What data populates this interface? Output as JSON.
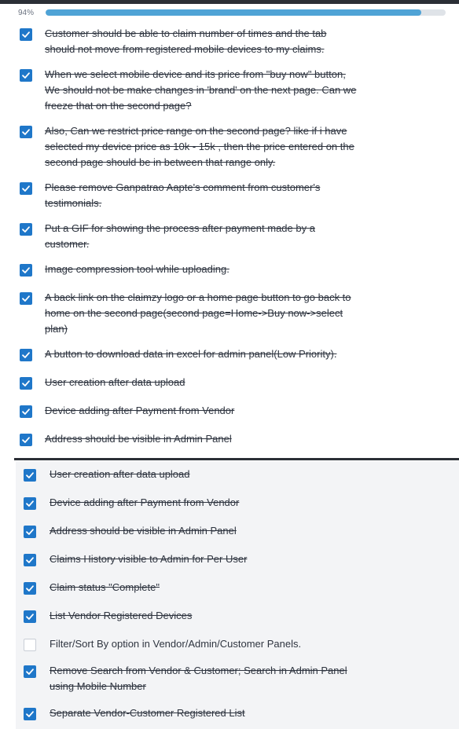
{
  "progress": {
    "percent_label": "94%",
    "fraction": 0.94
  },
  "colors": {
    "accent": "#1f77c9",
    "progress_fill": "#4fa3d6",
    "dark_chrome": "#2b2f36",
    "panel_bg": "#f3f4f6"
  },
  "icons": {
    "checked": "check-icon"
  },
  "list1": {
    "items": [
      {
        "lines": [
          "Customer should be able to claim number of times and the tab",
          "should not move from registered mobile devices to my claims."
        ],
        "checked": true
      },
      {
        "lines": [
          "When we select mobile device and its price from \"buy now\" button,",
          "We should not be make changes in 'brand' on the next page. Can we",
          "freeze that on the second page?"
        ],
        "checked": true
      },
      {
        "lines": [
          "Also, Can we restrict price range on the second page? like if i have",
          "selected my device price as 10k - 15k , then the price entered on the",
          "second page should be in between that range only."
        ],
        "checked": true
      },
      {
        "lines": [
          "Please remove Ganpatrao Aapte's comment from customer's",
          "testimonials."
        ],
        "checked": true
      },
      {
        "lines": [
          "Put a GIF for showing the process after payment made by a",
          "customer."
        ],
        "checked": true
      },
      {
        "lines": [
          "Image compression tool while uploading."
        ],
        "checked": true
      },
      {
        "lines": [
          "A back link on the claimzy logo or a home page button to go back to",
          "home on the second page(second page=Home->Buy now->select",
          "plan)"
        ],
        "checked": true
      },
      {
        "lines": [
          "A button to download data in excel for admin panel(Low Priority)."
        ],
        "checked": true
      },
      {
        "lines": [
          "User creation after data upload"
        ],
        "checked": true
      },
      {
        "lines": [
          "Device adding after Payment from Vendor"
        ],
        "checked": true
      },
      {
        "lines": [
          "Address should be visible in Admin Panel"
        ],
        "checked": true
      }
    ]
  },
  "list2": {
    "items": [
      {
        "lines": [
          "User creation after data upload"
        ],
        "checked": true
      },
      {
        "lines": [
          "Device adding after Payment from Vendor"
        ],
        "checked": true
      },
      {
        "lines": [
          "Address should be visible in Admin Panel"
        ],
        "checked": true
      },
      {
        "lines": [
          "Claims History visible to Admin for Per User"
        ],
        "checked": true
      },
      {
        "lines": [
          "Claim status \"Complete\""
        ],
        "checked": true
      },
      {
        "lines": [
          "List Vendor Registered Devices"
        ],
        "checked": true
      },
      {
        "lines": [
          "Filter/Sort By option in Vendor/Admin/Customer Panels."
        ],
        "checked": false
      },
      {
        "lines": [
          "Remove Search from Vendor & Customer; Search in Admin Panel",
          "using Mobile Number"
        ],
        "checked": true
      },
      {
        "lines": [
          "Separate Vendor-Customer Registered List"
        ],
        "checked": true
      }
    ]
  }
}
